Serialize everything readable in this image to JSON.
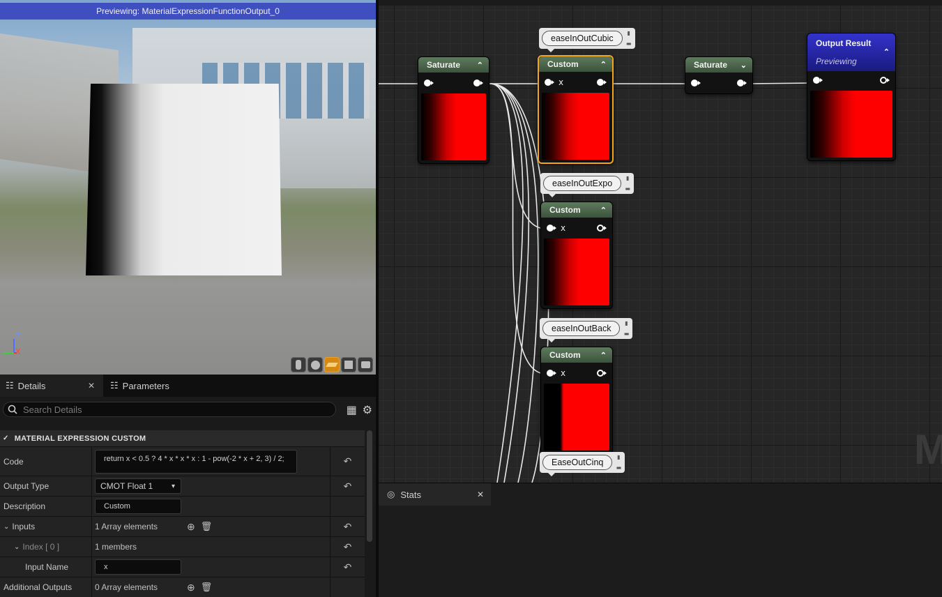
{
  "viewport": {
    "banner": "Previewing: MaterialExpressionFunctionOutput_0",
    "axis_z": "Z",
    "axis_x": "X"
  },
  "details": {
    "tabs": [
      {
        "label": "Details",
        "close": "✕"
      },
      {
        "label": "Parameters"
      }
    ],
    "search_placeholder": "Search Details",
    "category": "MATERIAL EXPRESSION CUSTOM",
    "rows": {
      "code_label": "Code",
      "code_value": "return x < 0.5 ? 4 * x * x * x : 1 - pow(-2 * x + 2, 3) / 2;",
      "output_type_label": "Output Type",
      "output_type_value": "CMOT Float 1",
      "description_label": "Description",
      "description_value": "Custom",
      "inputs_label": "Inputs",
      "inputs_value": "1 Array elements",
      "index_label": "Index [ 0 ]",
      "index_value": "1 members",
      "input_name_label": "Input Name",
      "input_name_value": "x",
      "additional_outputs_label": "Additional Outputs",
      "additional_outputs_value": "0 Array elements"
    }
  },
  "graph": {
    "nodes": {
      "saturate_left": {
        "title": "Saturate"
      },
      "custom_1": {
        "title": "Custom",
        "pin": "x"
      },
      "saturate_right": {
        "title": "Saturate"
      },
      "output": {
        "title": "Output Result",
        "subtitle": "Previewing"
      },
      "custom_2": {
        "title": "Custom",
        "pin": "x"
      },
      "custom_3": {
        "title": "Custom",
        "pin": "x"
      }
    },
    "comments": {
      "c1": "easeInOutCubic",
      "c2": "easeInOutExpo",
      "c3": "easeInOutBack",
      "c4": "EaseOutCinq"
    },
    "watermark": "M"
  },
  "stats": {
    "tab_label": "Stats",
    "close": "✕"
  },
  "colors": {
    "selection": "#f3a51c",
    "node_header": "#4f6b4f",
    "output_header": "#2a2ab5",
    "preview_banner": "#3f4fbf"
  }
}
